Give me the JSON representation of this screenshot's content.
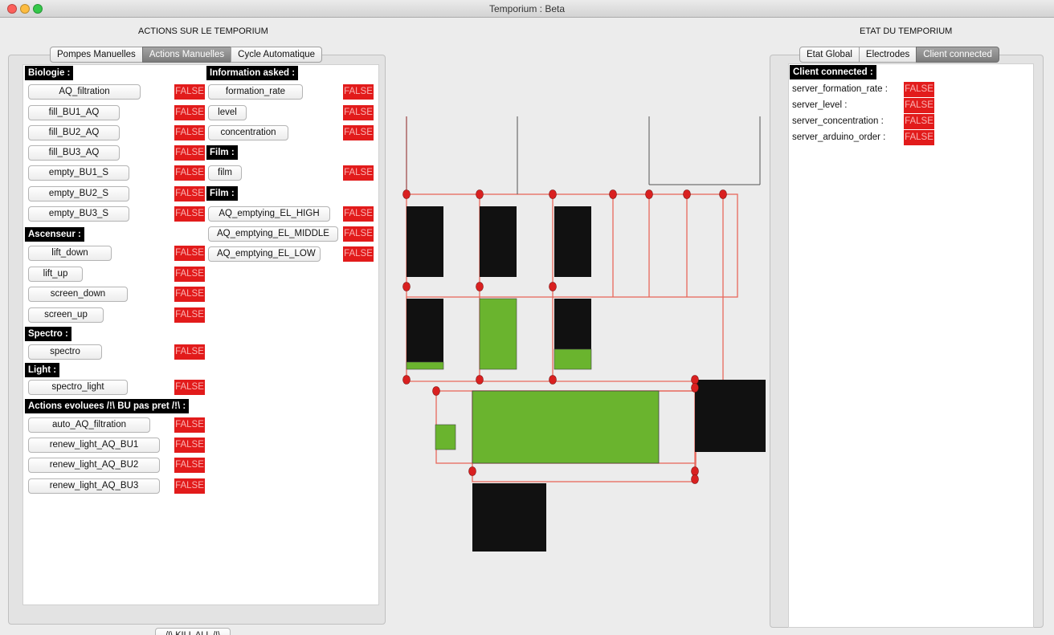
{
  "window": {
    "title": "Temporium : Beta"
  },
  "left": {
    "heading": "ACTIONS SUR LE TEMPORIUM",
    "tabs": [
      "Pompes Manuelles",
      "Actions Manuelles",
      "Cycle Automatique"
    ],
    "active_tab": "Actions Manuelles",
    "col1": {
      "biologie": {
        "label": "Biologie :",
        "buttons": [
          "AQ_filtration",
          "fill_BU1_AQ",
          "fill_BU2_AQ",
          "fill_BU3_AQ",
          "empty_BU1_S",
          "empty_BU2_S",
          "empty_BU3_S"
        ]
      },
      "ascenseur": {
        "label": "Ascenseur :",
        "buttons": [
          "lift_down",
          "lift_up",
          "screen_down",
          "screen_up"
        ]
      },
      "spectro": {
        "label": "Spectro :",
        "buttons": [
          "spectro"
        ]
      },
      "light": {
        "label": "Light :",
        "buttons": [
          "spectro_light"
        ]
      },
      "evoluees": {
        "label": "Actions evoluees  /!\\ BU pas pret /!\\ :",
        "buttons": [
          "auto_AQ_filtration",
          "renew_light_AQ_BU1",
          "renew_light_AQ_BU2",
          "renew_light_AQ_BU3"
        ]
      }
    },
    "col2": {
      "info": {
        "label": "Information asked :",
        "buttons": [
          "formation_rate",
          "level",
          "concentration"
        ]
      },
      "film1": {
        "label": "Film :",
        "buttons": [
          "film"
        ]
      },
      "film2": {
        "label": "Film :",
        "buttons": [
          "AQ_emptying_EL_HIGH",
          "AQ_emptying_EL_MIDDLE",
          "AQ_emptying_EL_LOW"
        ]
      }
    },
    "false_label": "FALSE",
    "kill_button": "/!\\ KILL ALL /!\\"
  },
  "right": {
    "heading": "ETAT DU TEMPORIUM",
    "tabs": [
      "Etat Global",
      "Electrodes",
      "Client connected"
    ],
    "active_tab": "Client connected",
    "section_label": "Client connected :",
    "rows": [
      {
        "label": "server_formation_rate :",
        "value": "FALSE"
      },
      {
        "label": "server_level :",
        "value": "FALSE"
      },
      {
        "label": "server_concentration :",
        "value": "FALSE"
      },
      {
        "label": "server_arduino_order :",
        "value": "FALSE"
      }
    ]
  },
  "colors": {
    "false_bg": "#e21b1b",
    "green_fill": "#6ab42e",
    "pipe": "#e8695c",
    "node": "#d92020"
  }
}
